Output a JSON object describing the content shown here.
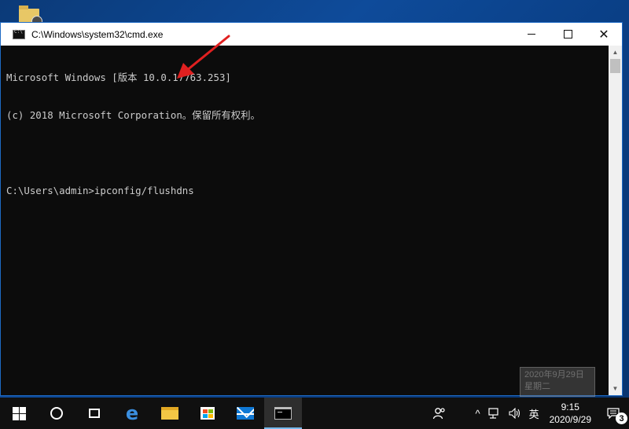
{
  "window": {
    "title": "C:\\Windows\\system32\\cmd.exe",
    "controls": {
      "minimize": "",
      "maximize": "",
      "close": "✕"
    }
  },
  "console": {
    "lines": [
      "Microsoft Windows [版本 10.0.17763.253]",
      "(c) 2018 Microsoft Corporation。保留所有权利。",
      "",
      "C:\\Users\\admin>ipconfig/flushdns"
    ]
  },
  "annotation": {
    "color": "#e02020"
  },
  "ghost_date": {
    "line1": "2020年9月29日",
    "line2": "星期二"
  },
  "taskbar": {
    "pinned": [
      "start-icon",
      "search-icon",
      "task-view-icon",
      "edge-icon",
      "file-explorer-icon",
      "store-icon",
      "mail-icon",
      "command-prompt-icon"
    ],
    "tray": {
      "people": "ዶ",
      "chevron": "^",
      "ime": "英",
      "time": "9:15",
      "date": "2020/9/29",
      "notification_count": "3"
    }
  },
  "colors": {
    "accent": "#76b9ed",
    "console_bg": "#0c0c0c",
    "console_fg": "#cccccc",
    "taskbar_bg": "#101010"
  }
}
